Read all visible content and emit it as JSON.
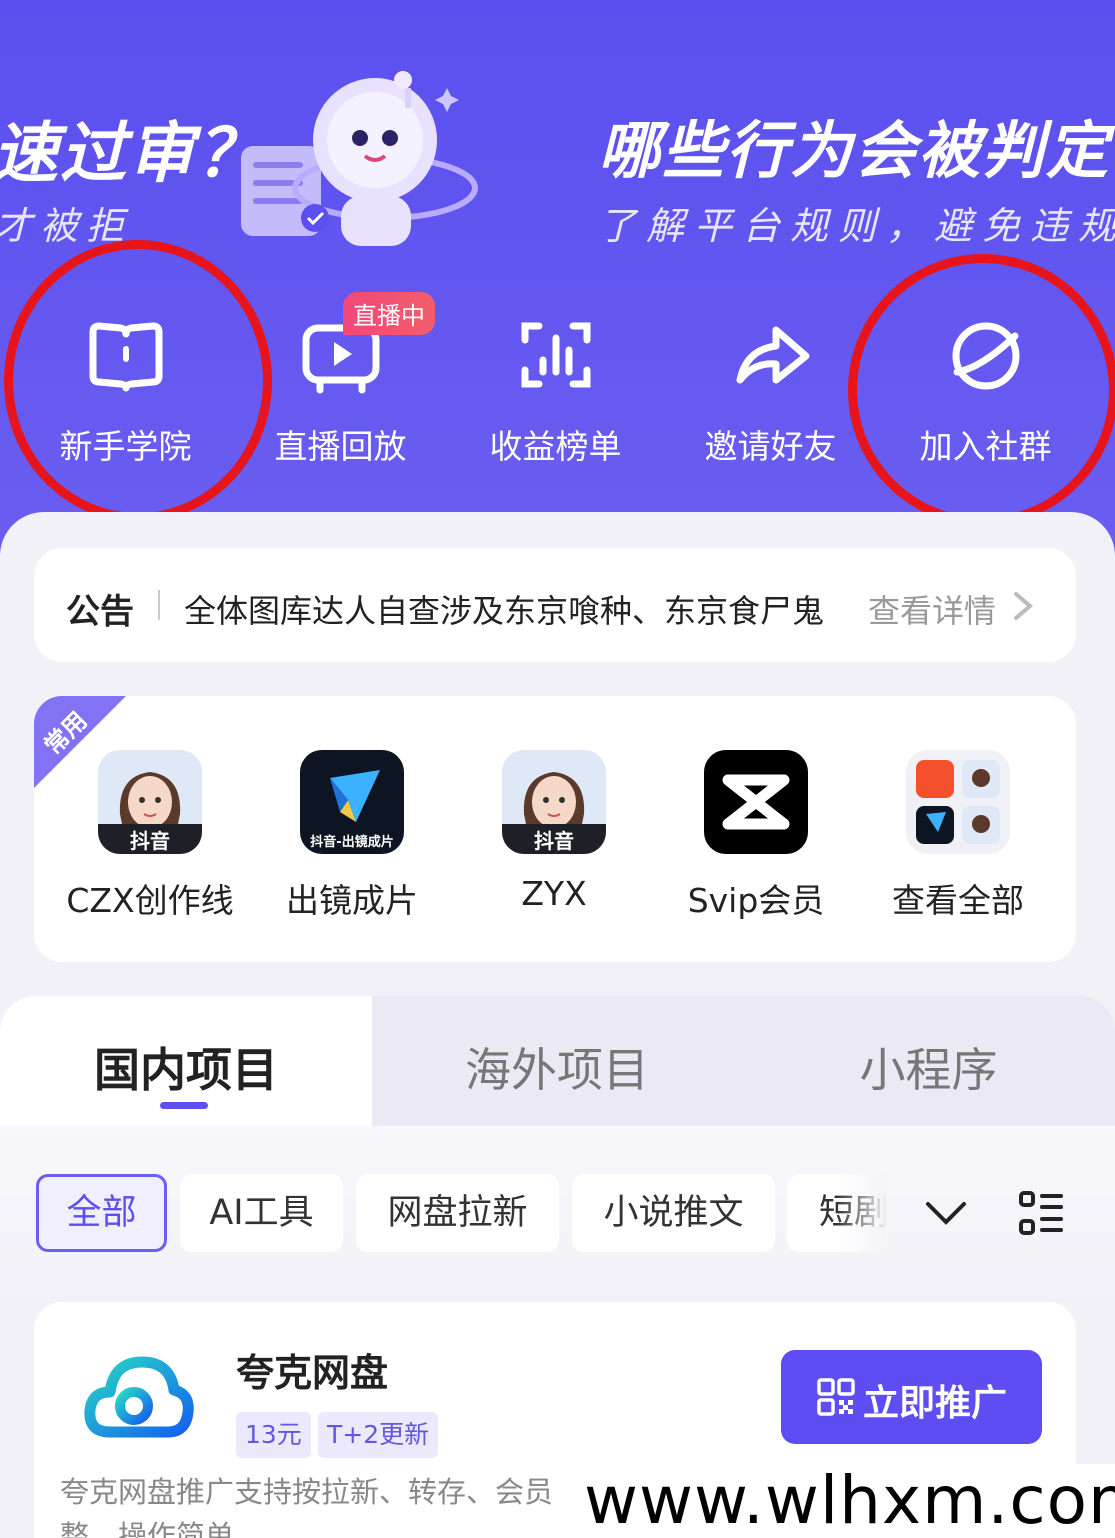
{
  "banner": {
    "left_title": "速过审？",
    "left_sub": "才被拒",
    "right_title": "哪些行为会被判定",
    "right_sub": "了解平台规则，避免违规风"
  },
  "quick_nav": {
    "items": [
      {
        "label": "新手学院",
        "icon": "book-icon"
      },
      {
        "label": "直播回放",
        "icon": "tv-play-icon"
      },
      {
        "label": "收益榜单",
        "icon": "chart-scan-icon"
      },
      {
        "label": "邀请好友",
        "icon": "share-arrow-icon"
      },
      {
        "label": "加入社群",
        "icon": "planet-icon"
      }
    ],
    "live_badge": "直播中"
  },
  "notice": {
    "title": "公告",
    "text": "全体图库达人自查涉及东京喰种、东京食尸鬼",
    "more": "查看详情"
  },
  "apps": {
    "corner_label": "常用",
    "items": [
      {
        "label": "CZX创作线",
        "icon_caption": "抖音"
      },
      {
        "label": "出镜成片",
        "icon_caption": "抖音-出镜成片"
      },
      {
        "label": "ZYX",
        "icon_caption": "抖音"
      },
      {
        "label": "Svip会员",
        "icon_caption": ""
      },
      {
        "label": "查看全部",
        "icon_caption": ""
      }
    ]
  },
  "tabs": [
    "国内项目",
    "海外项目",
    "小程序"
  ],
  "filters": [
    "全部",
    "AI工具",
    "网盘拉新",
    "小说推文",
    "短剧"
  ],
  "card": {
    "title": "夸克网盘",
    "tags": [
      "13元",
      "T+2更新"
    ],
    "button": "立即推广",
    "desc": "夸克网盘推广支持按拉新、转存、会员整，操作简单。"
  },
  "watermark": "www.wlhxm.com",
  "colors": {
    "brand": "#5b4fef",
    "circle": "#e8141c"
  }
}
